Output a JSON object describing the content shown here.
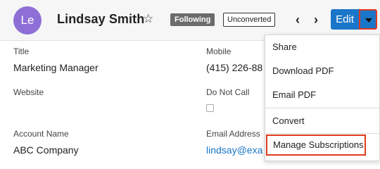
{
  "header": {
    "avatar_initials": "Le",
    "record_name": "Lindsay Smith",
    "follow_label": "Following",
    "status_label": "Unconverted",
    "edit_label": "Edit"
  },
  "fields": {
    "title_label": "Title",
    "title_value": "Marketing Manager",
    "mobile_label": "Mobile",
    "mobile_value": "(415) 226-88",
    "website_label": "Website",
    "donotcall_label": "Do Not Call",
    "account_label": "Account Name",
    "account_value": "ABC Company",
    "email_label": "Email Address",
    "email_value": "lindsay@exa"
  },
  "menu": {
    "items": [
      {
        "label": "Share"
      },
      {
        "label": "Download PDF"
      },
      {
        "label": "Email PDF"
      },
      {
        "label": "Convert"
      },
      {
        "label": "Manage Subscriptions"
      }
    ]
  },
  "colors": {
    "accent": "#1a76c9",
    "highlight_border": "#e03a1e",
    "avatar_bg": "#8e6fd6"
  }
}
